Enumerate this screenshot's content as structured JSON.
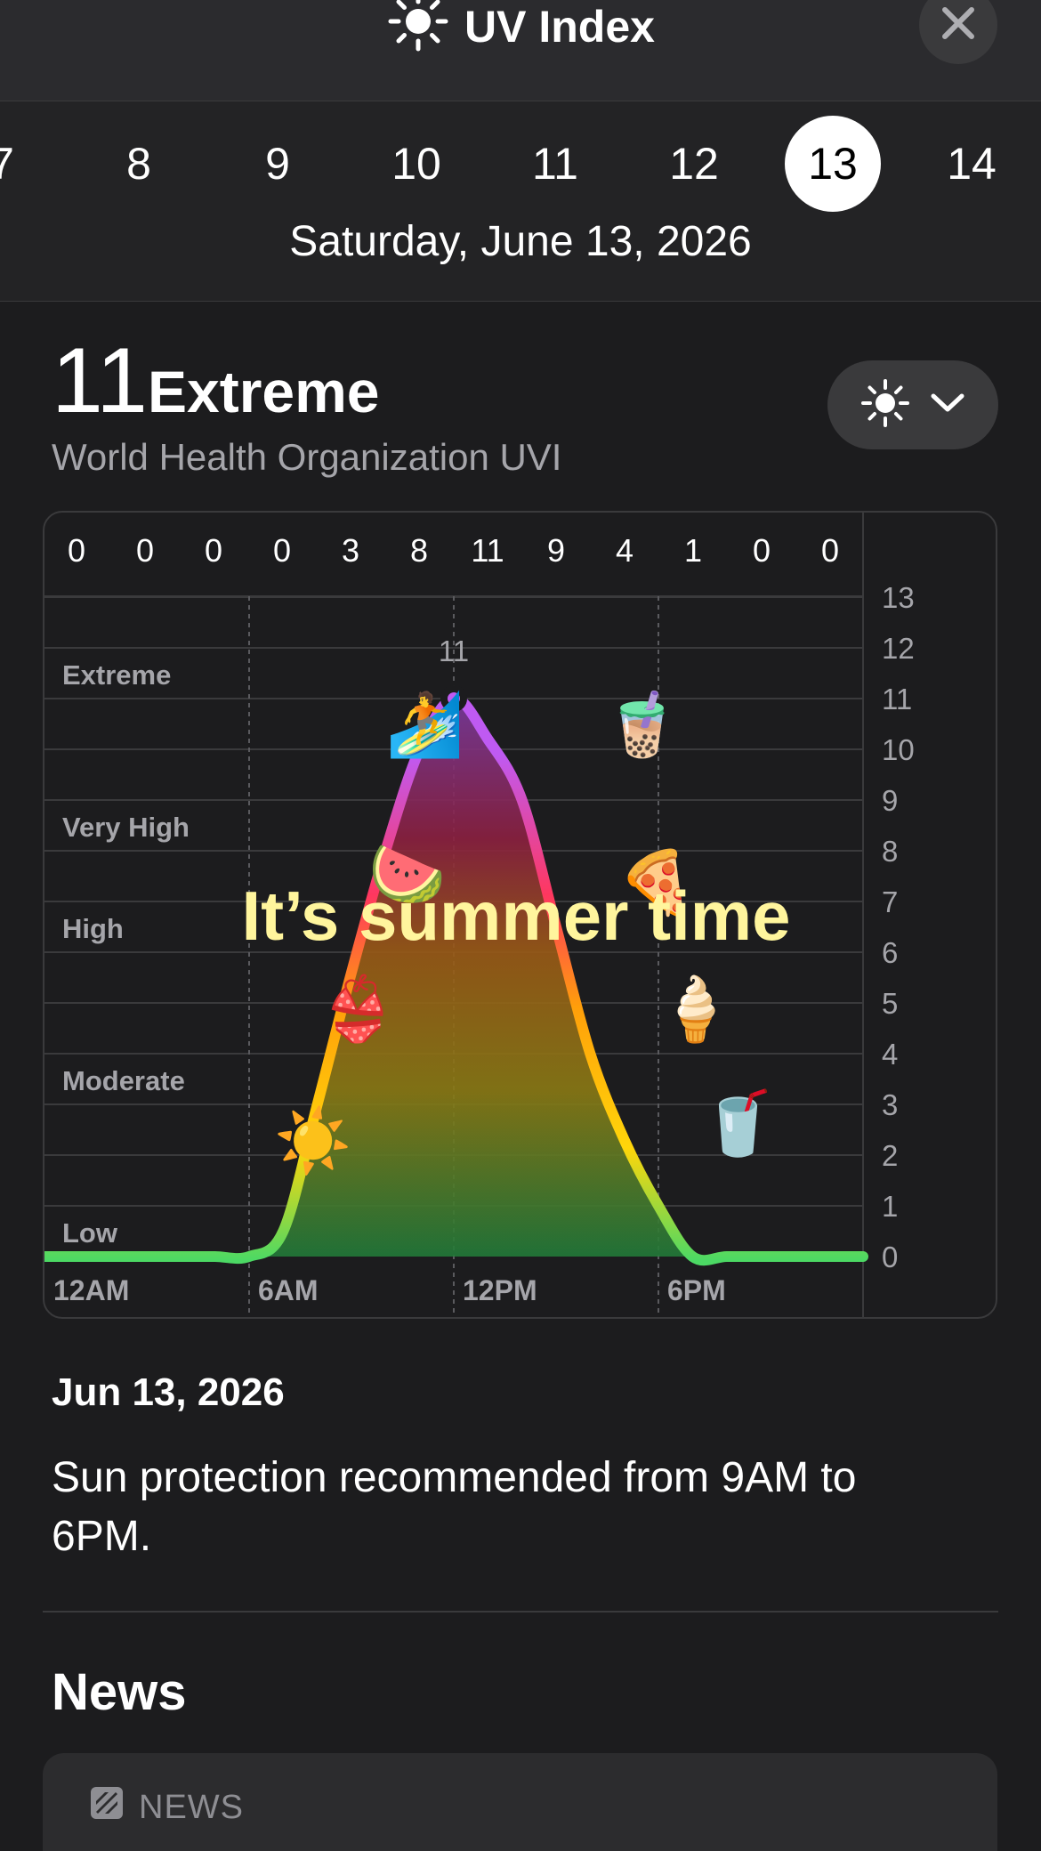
{
  "header": {
    "title": "UV Index",
    "icon": "sun-icon",
    "close_icon": "close-icon"
  },
  "day_strip": {
    "days": [
      "7",
      "8",
      "9",
      "10",
      "11",
      "12",
      "13",
      "14"
    ],
    "selected": "13",
    "full_date": "Saturday, June 13, 2026"
  },
  "summary": {
    "value": "11",
    "category": "Extreme",
    "source": "World Health Organization UVI",
    "toggle_icons": [
      "sun-icon",
      "chevron-down-icon"
    ]
  },
  "chart_data": {
    "type": "area",
    "hourly_labels": [
      "0",
      "0",
      "0",
      "0",
      "3",
      "8",
      "11",
      "9",
      "4",
      "1",
      "0",
      "0"
    ],
    "x_ticks": [
      "12AM",
      "6AM",
      "12PM",
      "6PM"
    ],
    "y_ticks": [
      0,
      1,
      2,
      3,
      4,
      5,
      6,
      7,
      8,
      9,
      10,
      11,
      12,
      13
    ],
    "ylim": [
      0,
      13
    ],
    "xlim_hours": [
      0,
      24
    ],
    "categories": [
      {
        "label": "Low",
        "min": 0
      },
      {
        "label": "Moderate",
        "min": 3
      },
      {
        "label": "High",
        "min": 6
      },
      {
        "label": "Very High",
        "min": 8
      },
      {
        "label": "Extreme",
        "min": 11
      }
    ],
    "series": [
      {
        "x": [
          "12AM",
          "1AM",
          "2AM",
          "3AM",
          "4AM",
          "5AM",
          "6AM",
          "7AM",
          "8AM",
          "9AM",
          "10AM",
          "11AM",
          "12PM",
          "1PM",
          "2PM",
          "3PM",
          "4PM",
          "5PM",
          "6PM",
          "7PM",
          "8PM",
          "9PM",
          "10PM",
          "11PM",
          "12AM"
        ],
        "values": [
          0,
          0,
          0,
          0,
          0,
          0,
          0,
          0.5,
          3,
          5.6,
          8,
          10,
          11,
          10.2,
          9,
          6.5,
          4,
          2.3,
          1,
          0,
          0,
          0,
          0,
          0,
          0
        ]
      }
    ],
    "peak_label": "11",
    "colors": {
      "low": "#4cd964",
      "moderate": "#ffd60a",
      "high": "#ff9f0a",
      "very_high": "#ff375f",
      "extreme": "#bf5af2"
    },
    "overlay_text": "It’s summer time",
    "emoji_stickers": [
      "☀️",
      "👙",
      "🍉",
      "🏄",
      "🧋",
      "🍕",
      "🍦",
      "🥤"
    ]
  },
  "details": {
    "date": "Jun 13, 2026",
    "advice": "Sun protection recommended from 9AM to 6PM."
  },
  "news": {
    "heading": "News",
    "source_label": "NEWS",
    "source_icon": "news-icon"
  }
}
